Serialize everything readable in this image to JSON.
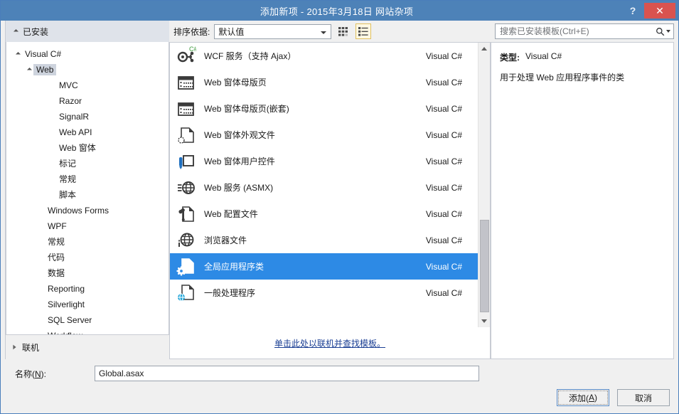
{
  "window": {
    "title": "添加新项 - 2015年3月18日 网站杂项",
    "help_label": "?",
    "close_label": "✕"
  },
  "toolbar": {
    "installed_label": "已安装",
    "sort_by_label": "排序依据:",
    "sort_by_value": "默认值",
    "view_grid_icon": "grid-view-icon",
    "view_list_icon": "list-view-icon",
    "search_placeholder": "搜索已安装模板(Ctrl+E)",
    "search_value": ""
  },
  "sidebar": {
    "items": [
      {
        "label": "Visual C#",
        "indent": 0,
        "expandable": true,
        "selected": false
      },
      {
        "label": "Web",
        "indent": 1,
        "expandable": true,
        "selected": true
      },
      {
        "label": "MVC",
        "indent": 3,
        "expandable": false,
        "selected": false
      },
      {
        "label": "Razor",
        "indent": 3,
        "expandable": false,
        "selected": false
      },
      {
        "label": "SignalR",
        "indent": 3,
        "expandable": false,
        "selected": false
      },
      {
        "label": "Web API",
        "indent": 3,
        "expandable": false,
        "selected": false
      },
      {
        "label": "Web 窗体",
        "indent": 3,
        "expandable": false,
        "selected": false
      },
      {
        "label": "标记",
        "indent": 3,
        "expandable": false,
        "selected": false
      },
      {
        "label": "常规",
        "indent": 3,
        "expandable": false,
        "selected": false
      },
      {
        "label": "脚本",
        "indent": 3,
        "expandable": false,
        "selected": false
      },
      {
        "label": "Windows Forms",
        "indent": 2,
        "expandable": false,
        "selected": false
      },
      {
        "label": "WPF",
        "indent": 2,
        "expandable": false,
        "selected": false
      },
      {
        "label": "常规",
        "indent": 2,
        "expandable": false,
        "selected": false
      },
      {
        "label": "代码",
        "indent": 2,
        "expandable": false,
        "selected": false
      },
      {
        "label": "数据",
        "indent": 2,
        "expandable": false,
        "selected": false
      },
      {
        "label": "Reporting",
        "indent": 2,
        "expandable": false,
        "selected": false
      },
      {
        "label": "Silverlight",
        "indent": 2,
        "expandable": false,
        "selected": false
      },
      {
        "label": "SQL Server",
        "indent": 2,
        "expandable": false,
        "selected": false
      },
      {
        "label": "Workflow",
        "indent": 2,
        "expandable": false,
        "selected": false
      }
    ],
    "online_label": "联机"
  },
  "templates": {
    "items": [
      {
        "name": "WCF 服务（支持 Ajax）",
        "lang": "Visual C#",
        "icon": "wcf-service-icon",
        "selected": false
      },
      {
        "name": "Web 窗体母版页",
        "lang": "Visual C#",
        "icon": "master-page-icon",
        "selected": false
      },
      {
        "name": "Web 窗体母版页(嵌套)",
        "lang": "Visual C#",
        "icon": "nested-master-page-icon",
        "selected": false
      },
      {
        "name": "Web 窗体外观文件",
        "lang": "Visual C#",
        "icon": "skin-file-icon",
        "selected": false
      },
      {
        "name": "Web 窗体用户控件",
        "lang": "Visual C#",
        "icon": "user-control-icon",
        "selected": false
      },
      {
        "name": "Web 服务 (ASMX)",
        "lang": "Visual C#",
        "icon": "web-service-icon",
        "selected": false
      },
      {
        "name": "Web 配置文件",
        "lang": "Visual C#",
        "icon": "config-file-icon",
        "selected": false
      },
      {
        "name": "浏览器文件",
        "lang": "Visual C#",
        "icon": "browser-file-icon",
        "selected": false
      },
      {
        "name": "全局应用程序类",
        "lang": "Visual C#",
        "icon": "global-app-class-icon",
        "selected": true
      },
      {
        "name": "一般处理程序",
        "lang": "Visual C#",
        "icon": "generic-handler-icon",
        "selected": false
      }
    ],
    "online_link": "单击此处以联机并查找模板。"
  },
  "details": {
    "type_label": "类型:",
    "type_value": "Visual C#",
    "description": "用于处理 Web 应用程序事件的类"
  },
  "footer": {
    "name_label_prefix": "名称(",
    "name_label_key": "N",
    "name_label_suffix": "):",
    "name_value": "Global.asax",
    "add_prefix": "添加(",
    "add_key": "A",
    "add_suffix": ")",
    "cancel_label": "取消"
  },
  "colors": {
    "title_bar": "#4d82b8",
    "selection": "#2d8ae5",
    "close_button": "#d9534f",
    "link": "#1b3f94"
  }
}
